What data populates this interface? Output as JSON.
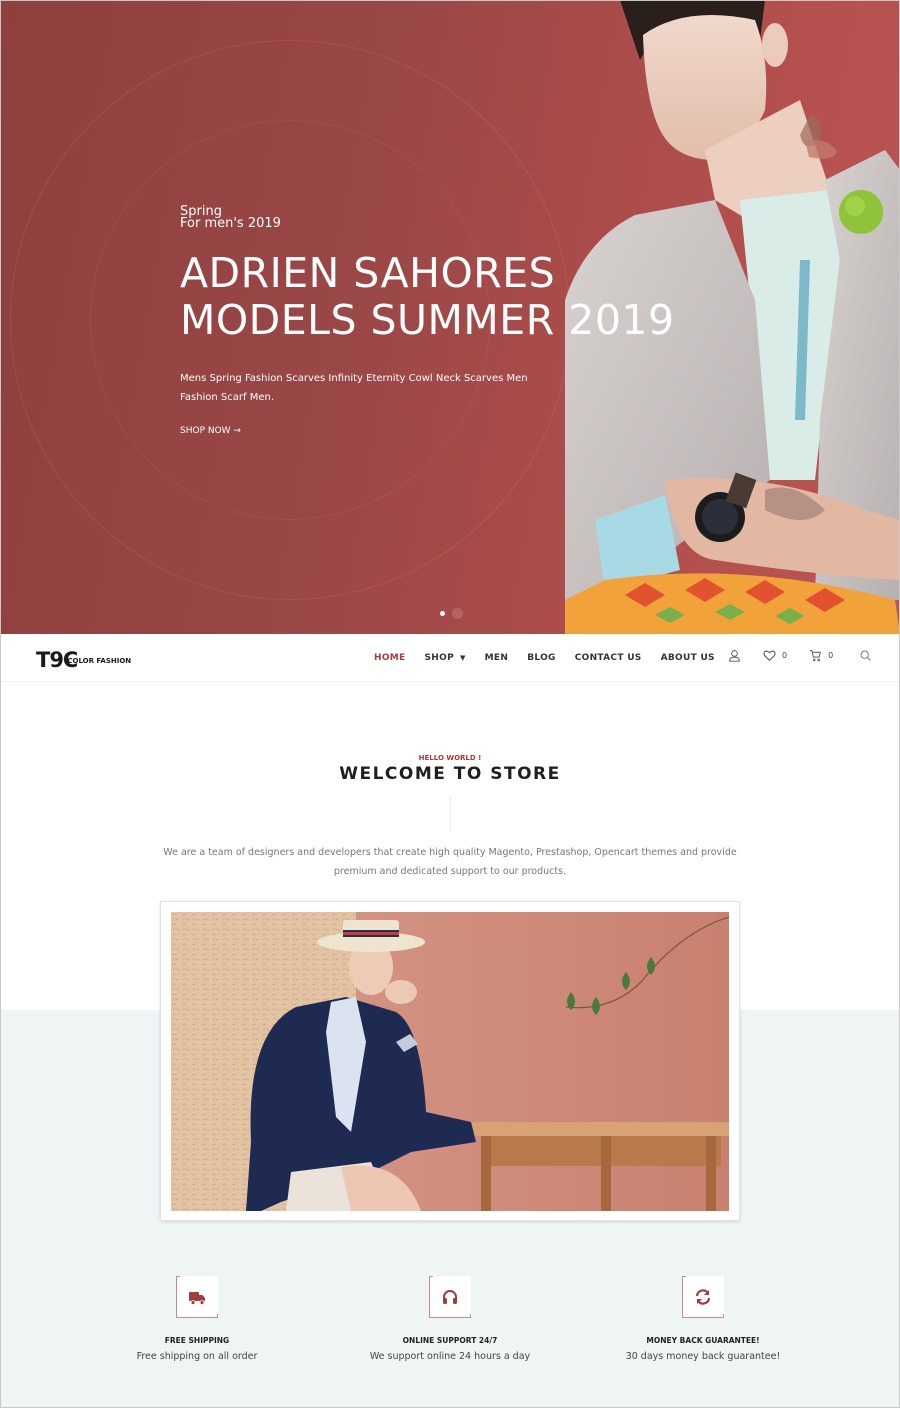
{
  "hero": {
    "eyebrow_line1": "Spring",
    "eyebrow_line2": "For men's 2019",
    "title_line1": "ADRIEN SAHORES",
    "title_line2": "MODELS SUMMER 2019",
    "description": "Mens Spring Fashion Scarves Infinity Eternity Cowl Neck Scarves Men Fashion Scarf Men.",
    "cta_label": "SHOP NOW →",
    "slides": {
      "total": 2,
      "active": 1
    },
    "colors": {
      "background": "#9a4747"
    }
  },
  "header": {
    "logo_mark": "T9C",
    "logo_text": "COLOR FASHION",
    "nav": [
      {
        "label": "HOME",
        "active": true
      },
      {
        "label": "SHOP",
        "dropdown": true
      },
      {
        "label": "MEN"
      },
      {
        "label": "BLOG"
      },
      {
        "label": "CONTACT US"
      },
      {
        "label": "ABOUT US"
      }
    ],
    "icons": {
      "account": "user-icon",
      "wishlist": "heart-icon",
      "wishlist_count": "0",
      "cart": "cart-icon",
      "cart_count": "0",
      "search": "search-icon"
    },
    "accent_color": "#a63a3a"
  },
  "welcome": {
    "eyebrow": "HELLO WORLD !",
    "title": "WELCOME TO STORE",
    "description": "We are a team of designers and developers that create high quality Magento, Prestashop, Opencart themes and provide premium and dedicated support to our products."
  },
  "features": [
    {
      "icon": "truck-icon",
      "title": "FREE SHIPPING",
      "desc": "Free shipping on all order"
    },
    {
      "icon": "headphones-icon",
      "title": "ONLINE SUPPORT 24/7",
      "desc": "We support online 24 hours a day"
    },
    {
      "icon": "refresh-icon",
      "title": "MONEY BACK GUARANTEE!",
      "desc": "30 days money back guarantee!"
    }
  ]
}
